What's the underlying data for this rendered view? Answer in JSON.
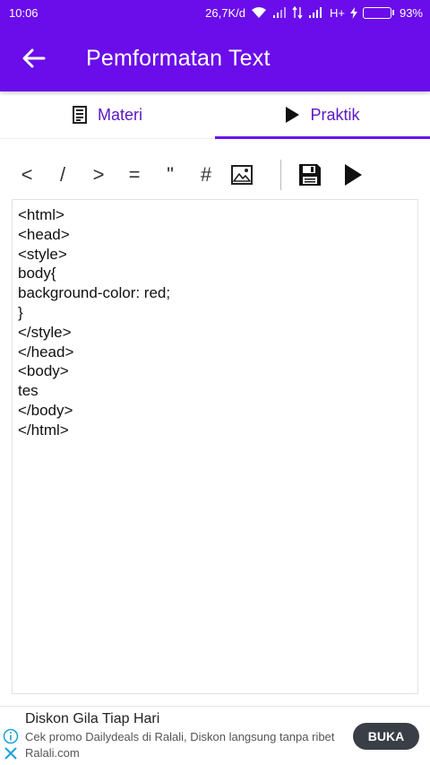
{
  "status": {
    "time": "10:06",
    "network_speed": "26,7K/d",
    "network_type": "H+",
    "battery": "93%",
    "battery_level": 0.93
  },
  "appbar": {
    "title": "Pemformatan Text",
    "back_icon": "arrow-left-icon"
  },
  "tabs": [
    {
      "label": "Materi",
      "icon": "document-icon",
      "active": false
    },
    {
      "label": "Praktik",
      "icon": "play-icon",
      "active": true
    }
  ],
  "toolbar": {
    "symbols": [
      "<",
      "/",
      ">",
      "=",
      "\"",
      "#"
    ],
    "image_icon": "image-icon",
    "save_icon": "save-icon",
    "run_icon": "play-icon"
  },
  "editor": {
    "content": "<html>\n<head>\n<style>\nbody{\nbackground-color: red;\n}\n</style>\n</head>\n<body>\ntes\n</body>\n</html>"
  },
  "ad": {
    "title": "Diskon Gila Tiap Hari",
    "description": "Cek promo Dailydeals di Ralali, Diskon langsung tanpa ribet",
    "host": "Ralali.com",
    "button_label": "BUKA"
  },
  "colors": {
    "primary": "#6a0dea",
    "tab_text": "#5b16c6",
    "ad_button": "#3a3f47",
    "battery_fill": "#4ce34c"
  }
}
